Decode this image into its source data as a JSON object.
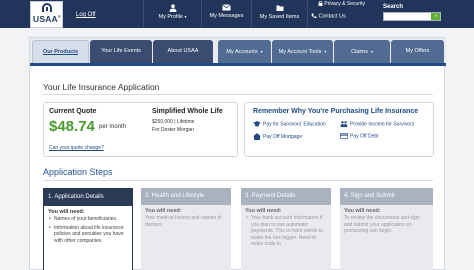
{
  "header": {
    "logo_text": "USAA",
    "logoff": "Log Off",
    "nav": [
      {
        "label": "My Profile",
        "chevron": "▾"
      },
      {
        "label": "My Messages"
      },
      {
        "label": "My Saved Items"
      }
    ],
    "privacy": "Privacy & Security",
    "contact": "Contact Us",
    "search": {
      "label": "Search",
      "placeholder": "",
      "button": "»"
    }
  },
  "tabs": [
    {
      "label": "Our Products"
    },
    {
      "label": "Your Life Events"
    },
    {
      "label": "About USAA"
    },
    {
      "label": "My Accounts",
      "chevron": "▾"
    },
    {
      "label": "My Account Tools",
      "chevron": "▾"
    },
    {
      "label": "Claims",
      "chevron": "▾"
    },
    {
      "label": "My Offers"
    }
  ],
  "page_title": "Your Life Insurance Application",
  "quote": {
    "heading": "Current Quote",
    "amount": "$48.74",
    "per": "per month",
    "link": "Can your quote change?"
  },
  "policy": {
    "heading": "Simplified Whole Life",
    "detail": "$250,000 | Lifetime",
    "insured": "For Dexter Morgan"
  },
  "remember": {
    "heading": "Remember Why You're Purchasing Life Insurance",
    "items": [
      {
        "label": "Pay for Survivors' Education",
        "icon": "graduation-cap-icon"
      },
      {
        "label": "Provide Income for Survivors",
        "icon": "people-icon"
      },
      {
        "label": "Pay Off Mortgage",
        "icon": "house-icon"
      },
      {
        "label": "Pay Off Debt",
        "icon": "credit-card-icon"
      }
    ]
  },
  "steps_title": "Application Steps",
  "steps": [
    {
      "title": "1. Application Details",
      "need": "You will need:",
      "items": [
        "Names of your beneficiaries.",
        "Information about life insurance policies and annuities you have with other companies"
      ]
    },
    {
      "title": "2. Health and Lifestyle",
      "need": "You will need:",
      "body": "Your medical history and names of doctors."
    },
    {
      "title": "3. Payment Details",
      "need": "You will need:",
      "items": [
        "Your bank account information if you plan to use automatic payments. This is more words to make the box bigger. Need to make code to"
      ]
    },
    {
      "title": "4. Sign and Submit",
      "need": "You will need:",
      "body": "To review the documents and sign and submit your application so processing can begin."
    }
  ],
  "colors": {
    "header_bg": "#21355a",
    "accent_green": "#4a9b2e",
    "link_blue": "#244a85",
    "active_step": "#2a3a55"
  }
}
